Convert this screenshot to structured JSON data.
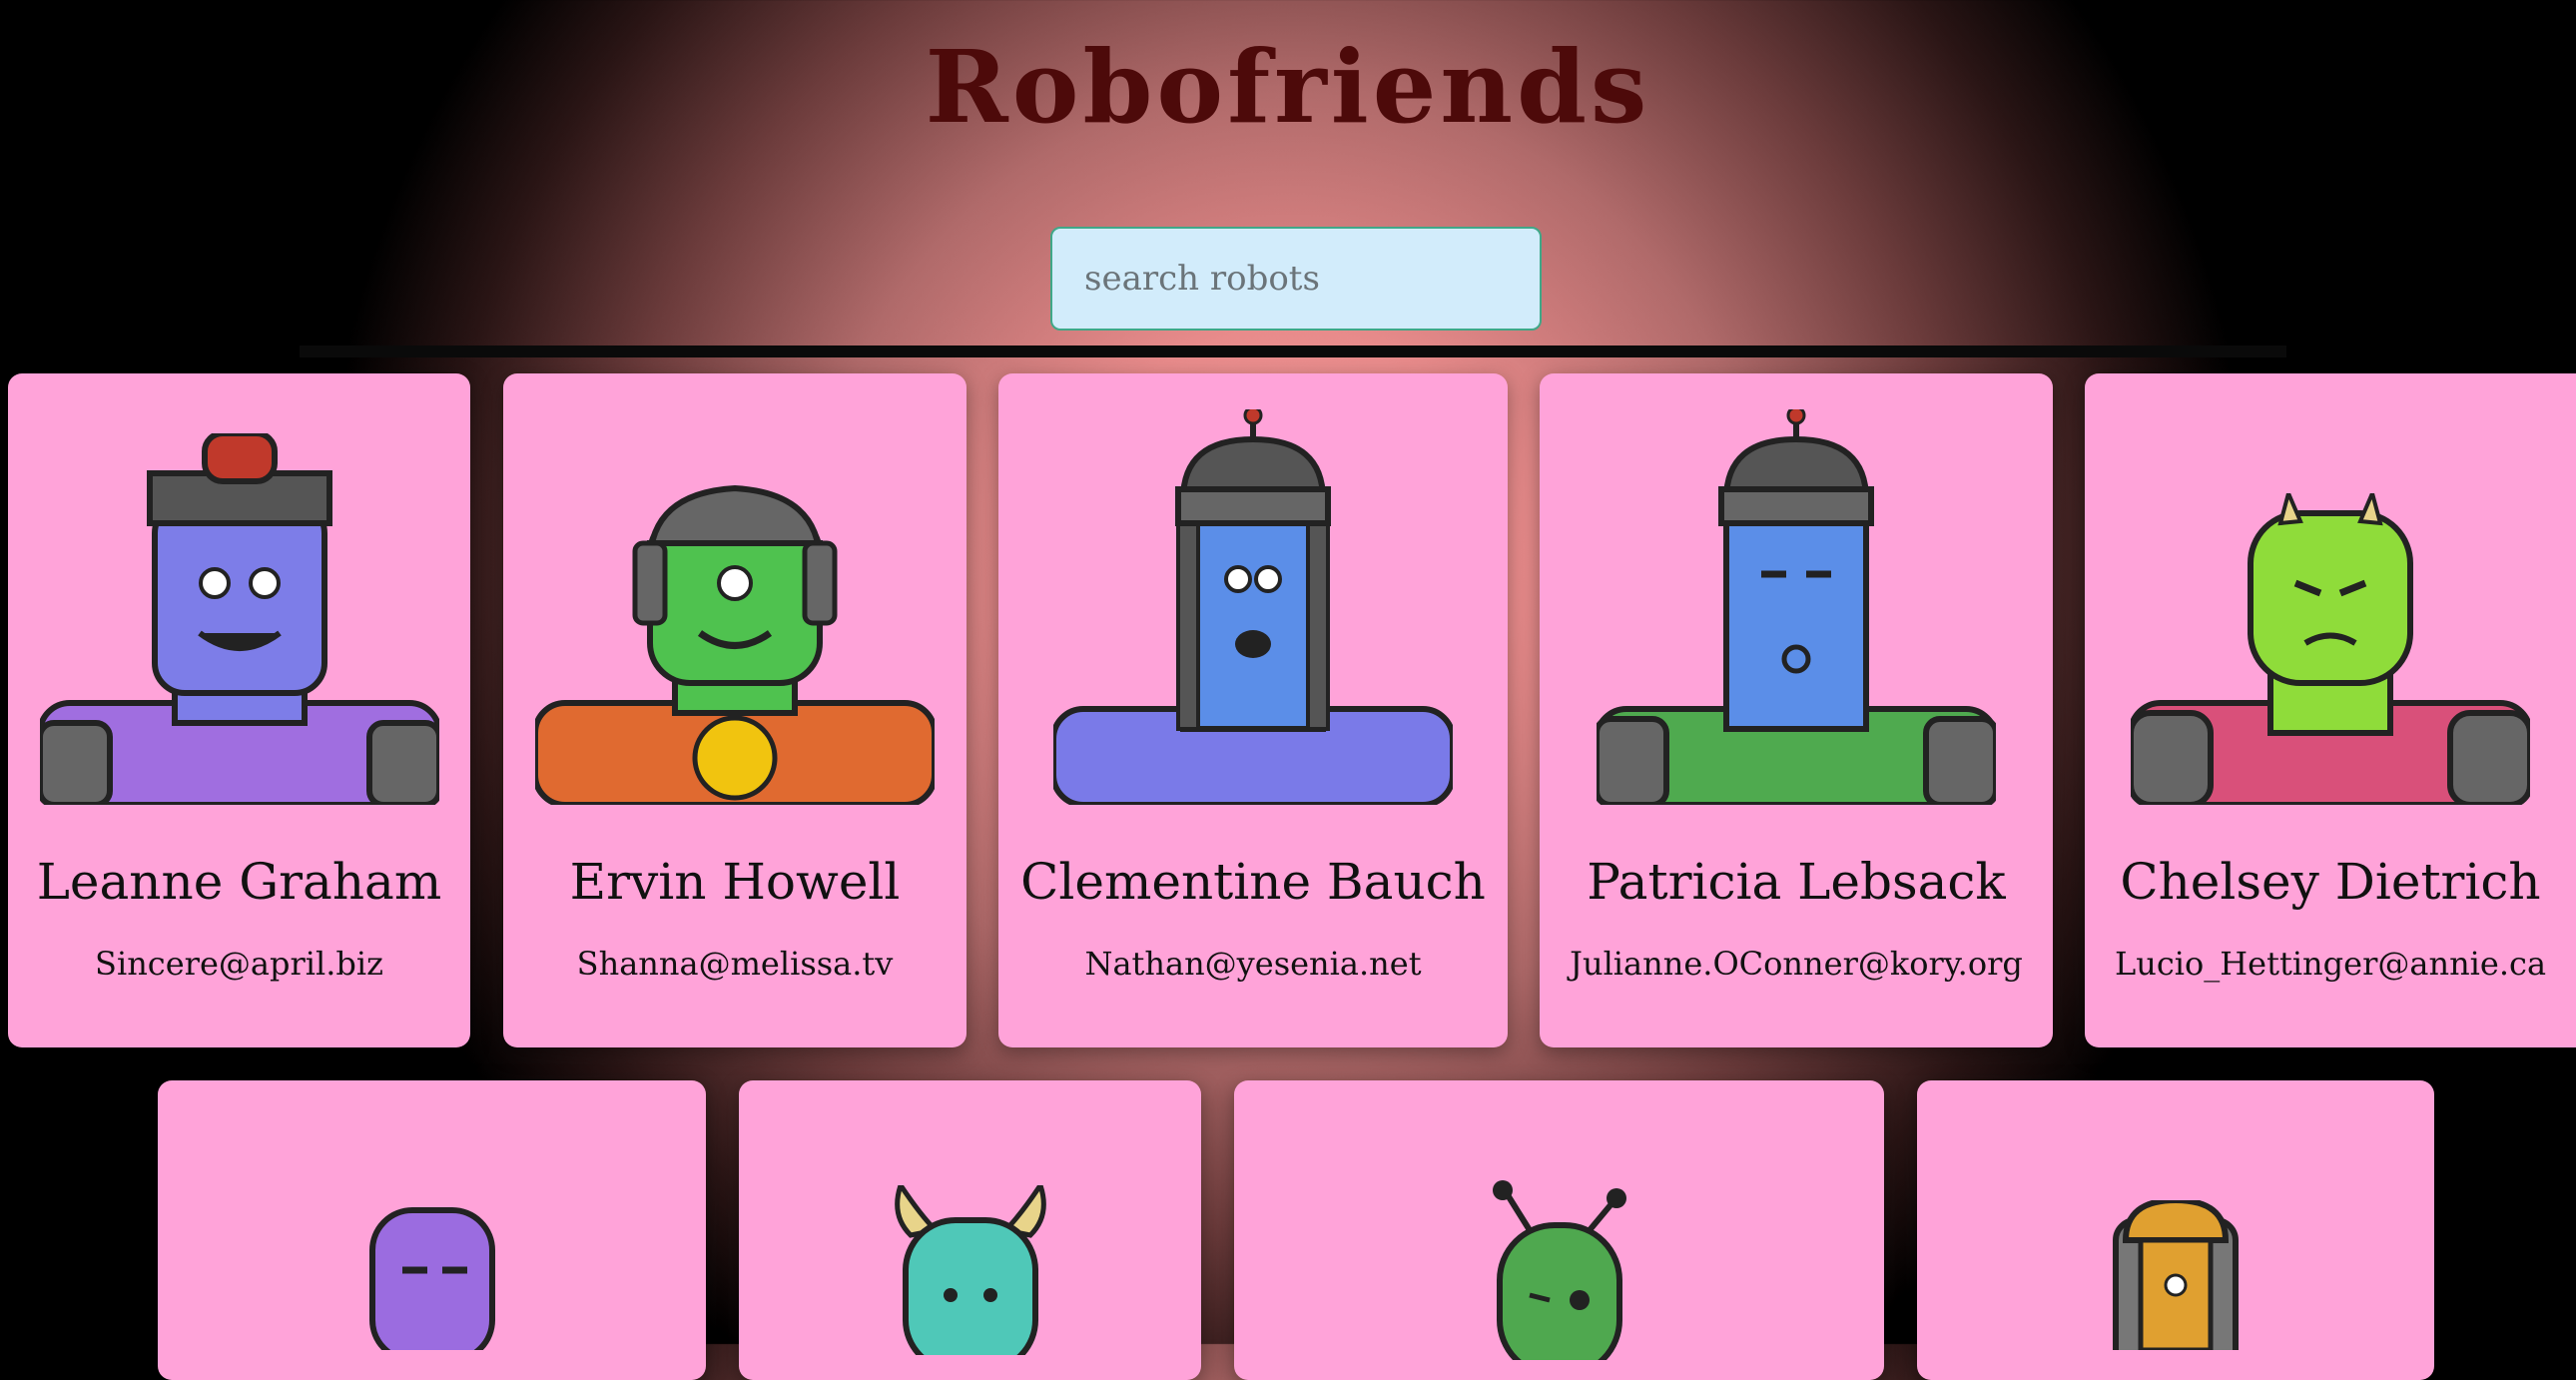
{
  "app": {
    "title": "Robofriends"
  },
  "search": {
    "placeholder": "search robots",
    "value": ""
  },
  "robots": [
    {
      "name": "Leanne Graham",
      "email": "Sincere@april.biz",
      "colors": {
        "skin": "#7d7de8",
        "shirt": "#a06ee0"
      }
    },
    {
      "name": "Ervin Howell",
      "email": "Shanna@melissa.tv",
      "colors": {
        "skin": "#4fc24f",
        "shirt": "#e06a30"
      }
    },
    {
      "name": "Clementine Bauch",
      "email": "Nathan@yesenia.net",
      "colors": {
        "skin": "#5b8ee8",
        "shirt": "#7a7ae8"
      }
    },
    {
      "name": "Patricia Lebsack",
      "email": "Julianne.OConner@kory.org",
      "colors": {
        "skin": "#5b8ee8",
        "shirt": "#4faa4f"
      }
    },
    {
      "name": "Chelsey Dietrich",
      "email": "Lucio_Hettinger@annie.ca",
      "colors": {
        "skin": "#8fdc3a",
        "shirt": "#d9507a"
      }
    }
  ],
  "partial_robots": [
    {
      "colors": {
        "skin": "#9b6ce0"
      }
    },
    {
      "colors": {
        "skin": "#4fc8b8"
      }
    },
    {
      "colors": {
        "skin": "#4fa84f"
      }
    },
    {
      "colors": {
        "skin": "#e0a030"
      }
    }
  ]
}
